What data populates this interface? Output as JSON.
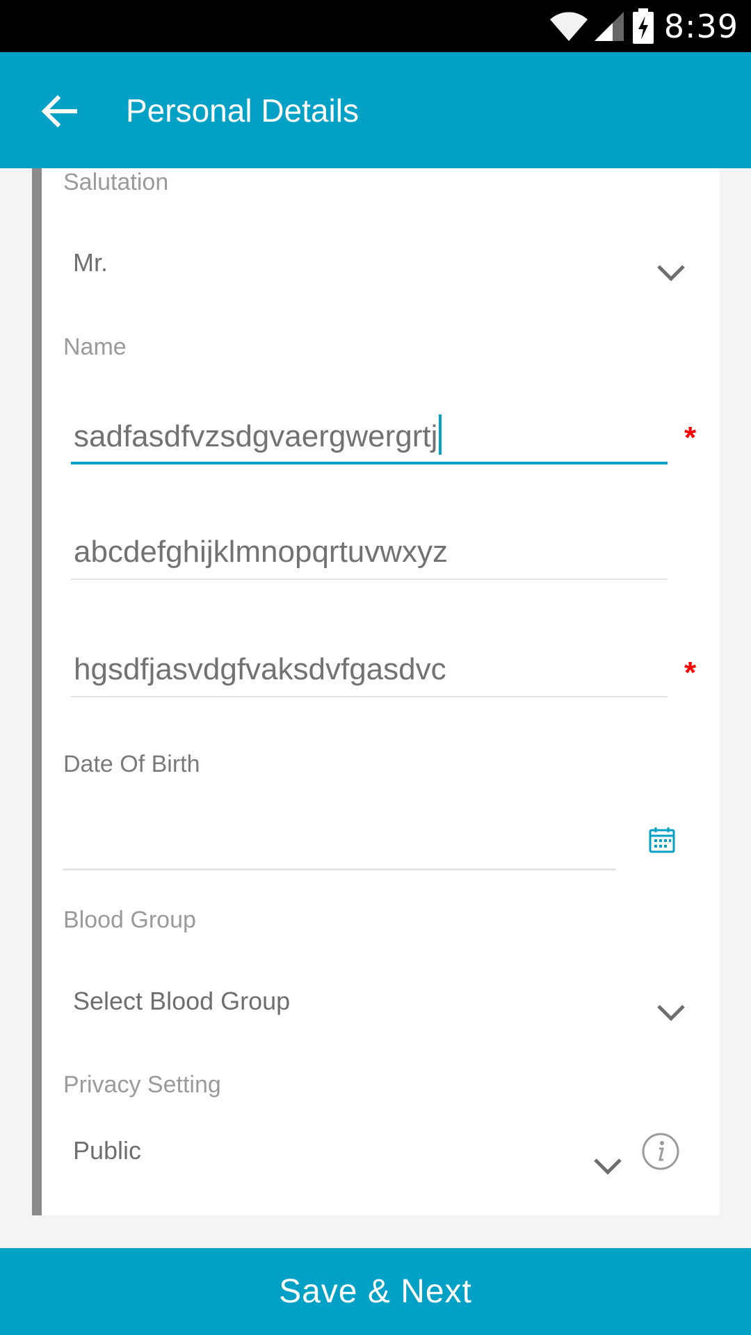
{
  "status_bar": {
    "time": "8:39",
    "icons": [
      "wifi-icon",
      "signal-icon",
      "battery-charging-icon"
    ]
  },
  "app_bar": {
    "back_icon": "arrow-left-icon",
    "title": "Personal Details"
  },
  "form": {
    "salutation": {
      "label": "Salutation",
      "value": "Mr."
    },
    "name": {
      "label": "Name",
      "first_name": {
        "value": "sadfasdfvzsdgvaergwergrtj",
        "required": true,
        "focused": true
      },
      "middle_name": {
        "value": "abcdefghijklmnopqrtuvwxyz",
        "required": false
      },
      "last_name": {
        "value": "hgsdfjasvdgfvaksdvfgasdvc",
        "required": true
      },
      "required_marker": "*"
    },
    "date_of_birth": {
      "label": "Date Of Birth",
      "value": "",
      "icon": "calendar-icon"
    },
    "blood_group": {
      "label": "Blood Group",
      "value": "Select Blood Group"
    },
    "privacy_setting": {
      "label": "Privacy Setting",
      "value": "Public",
      "info_icon": "info-icon"
    }
  },
  "footer": {
    "save_label": "Save & Next"
  },
  "colors": {
    "accent": "#03a1c6",
    "required": "#ff0000",
    "status_bar": "#000000",
    "background": "#f4f4f4"
  }
}
